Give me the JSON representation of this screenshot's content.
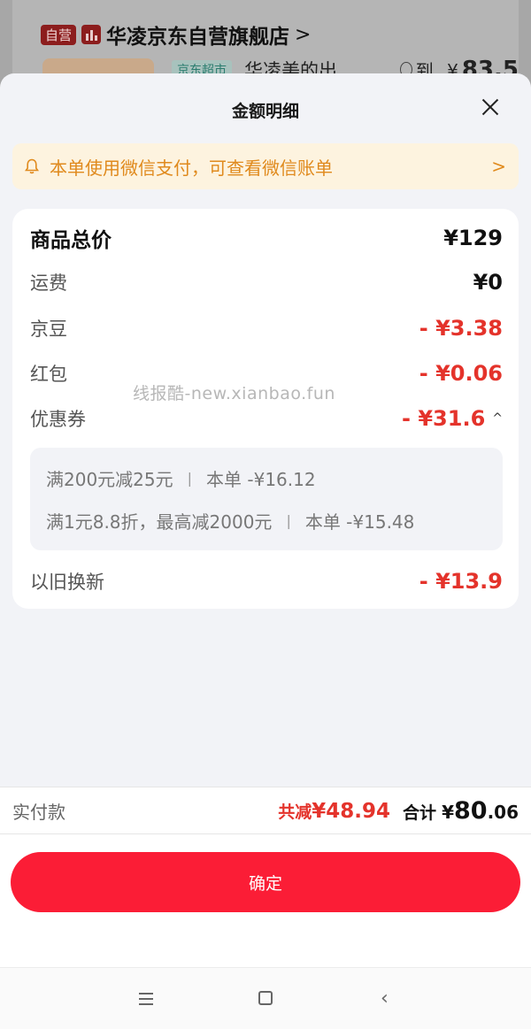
{
  "background": {
    "store": {
      "self_tag": "自营",
      "name": "华凌京东自营旗舰店",
      "arrow": ">"
    },
    "product": {
      "tag": "京东超市",
      "title_partial": "华凌美的出",
      "price_label": "到手",
      "price_prefix": "¥",
      "price_partial": "83.5"
    }
  },
  "sheet": {
    "title": "金额明细",
    "notice": {
      "text": "本单使用微信支付，可查看微信账单",
      "chevron": ">"
    },
    "details": {
      "total_label": "商品总价",
      "total_value": "¥129",
      "shipping_label": "运费",
      "shipping_value": "¥0",
      "beans_label": "京豆",
      "beans_value": "- ¥3.38",
      "redpacket_label": "红包",
      "redpacket_value": "- ¥0.06",
      "coupon_label": "优惠券",
      "coupon_value": "- ¥31.6",
      "coupon_toggle": "^",
      "coupons": [
        {
          "name": "满200元减25元",
          "sep": "|",
          "amount": "本单 -¥16.12"
        },
        {
          "name": "满1元8.8折，最高减2000元",
          "sep": "|",
          "amount": "本单 -¥15.48"
        }
      ],
      "tradein_label": "以旧换新",
      "tradein_value": "- ¥13.9"
    },
    "watermark": "线报酷-new.xianbao.fun"
  },
  "paybar": {
    "label": "实付款",
    "save_label": "共减",
    "save_amount": "¥48.94",
    "sum_label": "合计",
    "sum_currency": "¥",
    "sum_integer": "80",
    "sum_decimal": ".06"
  },
  "confirm_label": "确定",
  "colors": {
    "accent_red": "#e4332b",
    "button_red": "#fb1d36",
    "notice_orange": "#e08a1d",
    "notice_bg": "#fdf3df"
  }
}
